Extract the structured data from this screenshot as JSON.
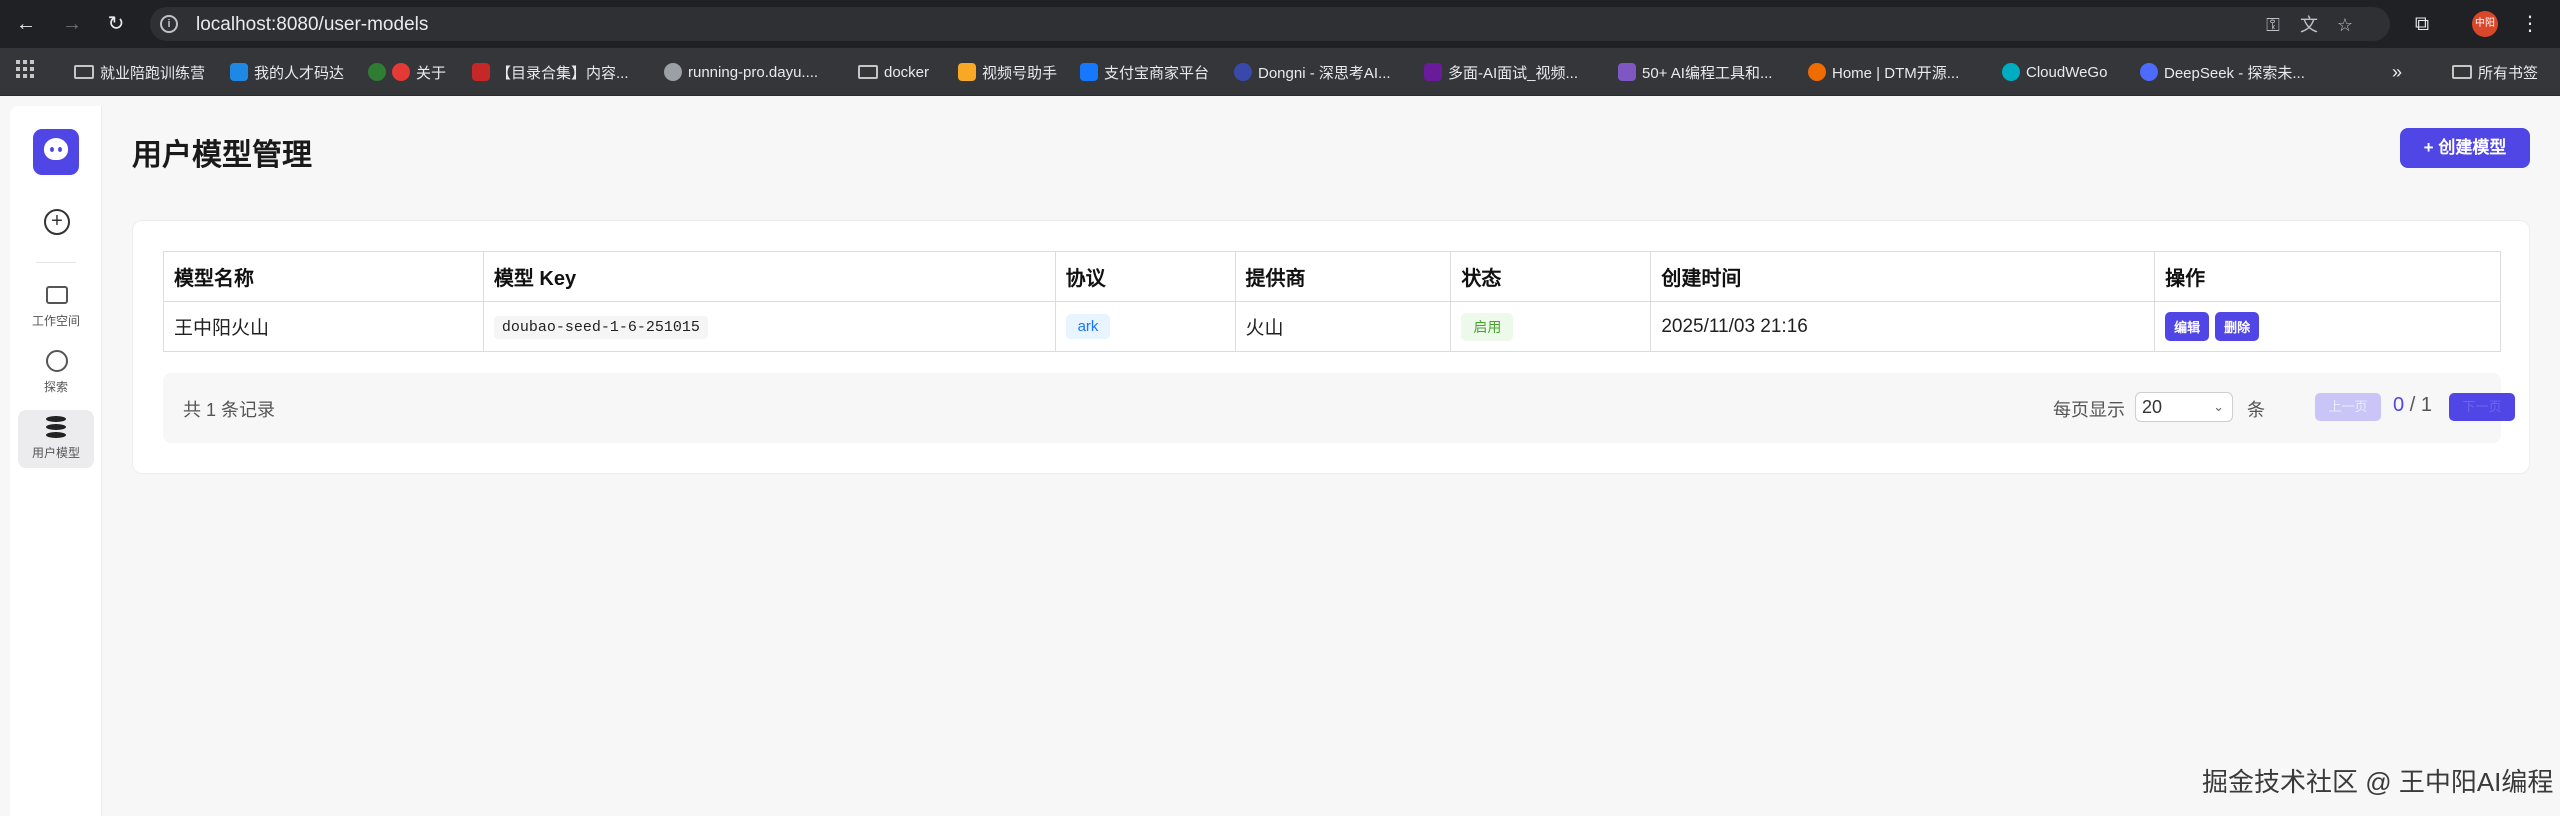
{
  "browser": {
    "url": "localhost:8080/user-models",
    "bookmarks": [
      {
        "label": "就业陪跑训练营",
        "icon": "folder-icon"
      },
      {
        "label": "我的人才码达",
        "icon": "site-icon",
        "color": "#1e88e5"
      },
      {
        "label": "关于",
        "icon": "site-icon",
        "color": "#2e7d32"
      },
      {
        "label": "",
        "icon": "site-icon",
        "color": "#e53935"
      },
      {
        "label": "【目录合集】内容...",
        "icon": "site-icon",
        "color": "#c62828"
      },
      {
        "label": "running-pro.dayu....",
        "icon": "globe-icon",
        "color": "#9aa0a6"
      },
      {
        "label": "docker",
        "icon": "folder-icon"
      },
      {
        "label": "视频号助手",
        "icon": "site-icon",
        "color": "#f9a825"
      },
      {
        "label": "支付宝商家平台",
        "icon": "site-icon",
        "color": "#1677ff"
      },
      {
        "label": "Dongni - 深思考AI...",
        "icon": "site-icon",
        "color": "#3949ab"
      },
      {
        "label": "多面-AI面试_视频...",
        "icon": "site-icon",
        "color": "#6a1b9a"
      },
      {
        "label": "50+ AI编程工具和...",
        "icon": "site-icon",
        "color": "#7e57c2"
      },
      {
        "label": "Home | DTM开源...",
        "icon": "site-icon",
        "color": "#ef6c00"
      },
      {
        "label": "CloudWeGo",
        "icon": "site-icon",
        "color": "#00acc1"
      },
      {
        "label": "DeepSeek - 探索未...",
        "icon": "site-icon",
        "color": "#4d6bfe"
      }
    ],
    "more_bookmarks": "所有书签",
    "profile_text": "中阳"
  },
  "sidebar": {
    "items": [
      {
        "label": "工作空间",
        "icon": "terminal-icon"
      },
      {
        "label": "探索",
        "icon": "compass-icon"
      },
      {
        "label": "用户模型",
        "icon": "database-icon"
      }
    ]
  },
  "page": {
    "title": "用户模型管理",
    "create_button": "+ 创建模型"
  },
  "table": {
    "columns": [
      "模型名称",
      "模型 Key",
      "协议",
      "提供商",
      "状态",
      "创建时间",
      "操作"
    ],
    "rows": [
      {
        "name": "王中阳火山",
        "key": "doubao-seed-1-6-251015",
        "protocol": "ark",
        "provider": "火山",
        "status": "启用",
        "created": "2025/11/03 21:16",
        "edit": "编辑",
        "delete": "删除"
      }
    ]
  },
  "pagination": {
    "total": "共 1 条记录",
    "page_size_label": "每页显示",
    "page_size": "20",
    "unit": "条",
    "prev": "上一页",
    "current": "0",
    "separator": "/",
    "pages": "1",
    "next": "下一页"
  },
  "watermark": "掘金技术社区 @ 王中阳AI编程",
  "colors": {
    "accent": "#4f46e5",
    "protocol": "#1677ff",
    "status": "#48a52c"
  }
}
